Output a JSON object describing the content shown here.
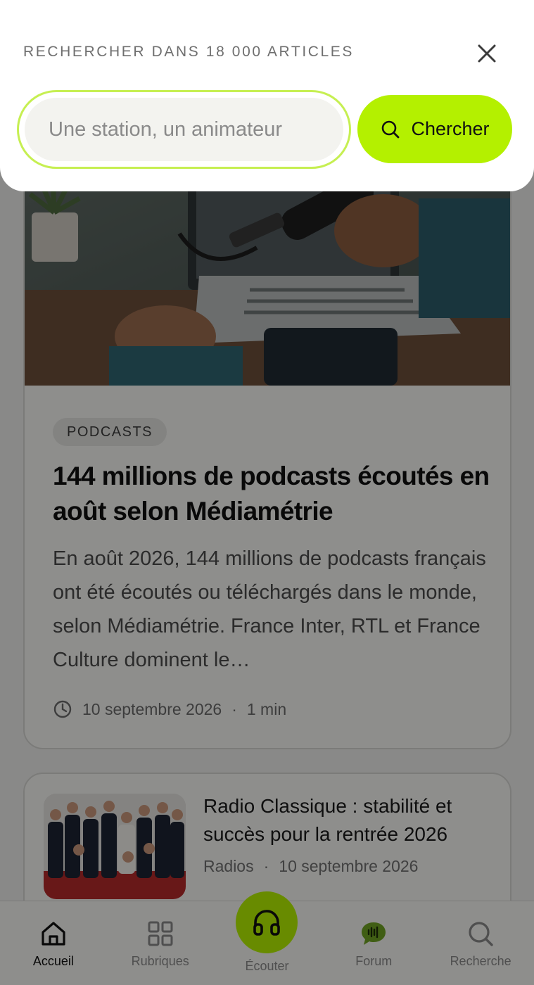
{
  "search": {
    "heading": "RECHERCHER DANS 18 000 ARTICLES",
    "placeholder": "Une station, un animateur",
    "value": "",
    "button_label": "Chercher",
    "accent_color": "#b4f000"
  },
  "featured_article": {
    "category": "PODCASTS",
    "title": "144 millions de podcasts écoutés en août selon Médiamétrie",
    "excerpt": "En août 2026, 144 millions de podcasts français ont été écoutés ou téléchargés dans le monde, selon Médiamétrie. France Inter, RTL et France Culture dominent le…",
    "date": "10 septembre 2026",
    "separator": "·",
    "read_time": "1 min"
  },
  "second_article": {
    "title": "Radio Classique : stabilité et succès pour la rentrée 2026",
    "category": "Radios",
    "separator": "·",
    "date": "10 septembre 2026"
  },
  "bottom_nav": {
    "items": [
      {
        "label": "Accueil",
        "icon": "home-icon",
        "active": true
      },
      {
        "label": "Rubriques",
        "icon": "grid-icon",
        "active": false
      },
      {
        "label": "Écouter",
        "icon": "headphones-icon",
        "active": false
      },
      {
        "label": "Forum",
        "icon": "chat-bubble-icon",
        "active": false
      },
      {
        "label": "Recherche",
        "icon": "search-icon",
        "active": false
      }
    ]
  }
}
